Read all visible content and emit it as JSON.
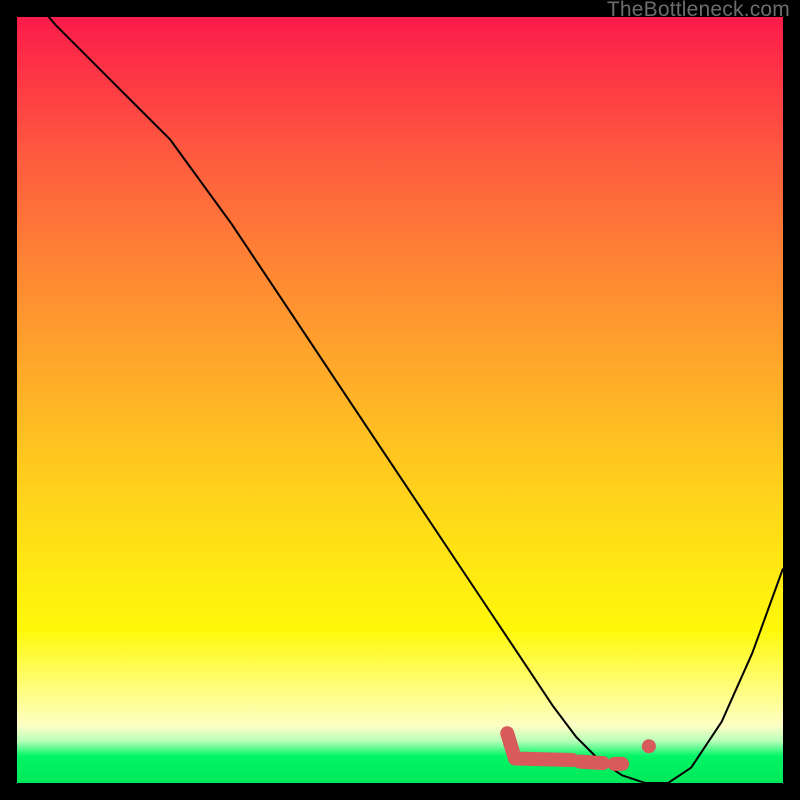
{
  "watermark": "TheBottleneck.com",
  "chart_data": {
    "type": "line",
    "title": "",
    "xlabel": "",
    "ylabel": "",
    "xlim": [
      0,
      100
    ],
    "ylim": [
      0,
      100
    ],
    "x": [
      0,
      5,
      12,
      20,
      28,
      36,
      44,
      52,
      60,
      66,
      70,
      73,
      76,
      79,
      82,
      85,
      88,
      92,
      96,
      100
    ],
    "values": [
      105,
      99,
      92,
      84,
      73,
      61,
      49,
      37,
      25,
      16,
      10,
      6,
      3,
      1,
      0,
      0,
      2,
      8,
      17,
      28
    ],
    "markers": {
      "l_segment": {
        "x": [
          64,
          65,
          72.5
        ],
        "y": [
          6.5,
          3.2,
          3.0
        ]
      },
      "dash1": {
        "x": [
          73.5,
          76.5
        ],
        "y": [
          2.8,
          2.6
        ]
      },
      "dash2": {
        "x": [
          78.0,
          79.0
        ],
        "y": [
          2.5,
          2.5
        ]
      },
      "dot": {
        "x": 82.5,
        "y": 4.8
      }
    },
    "annotations": []
  }
}
